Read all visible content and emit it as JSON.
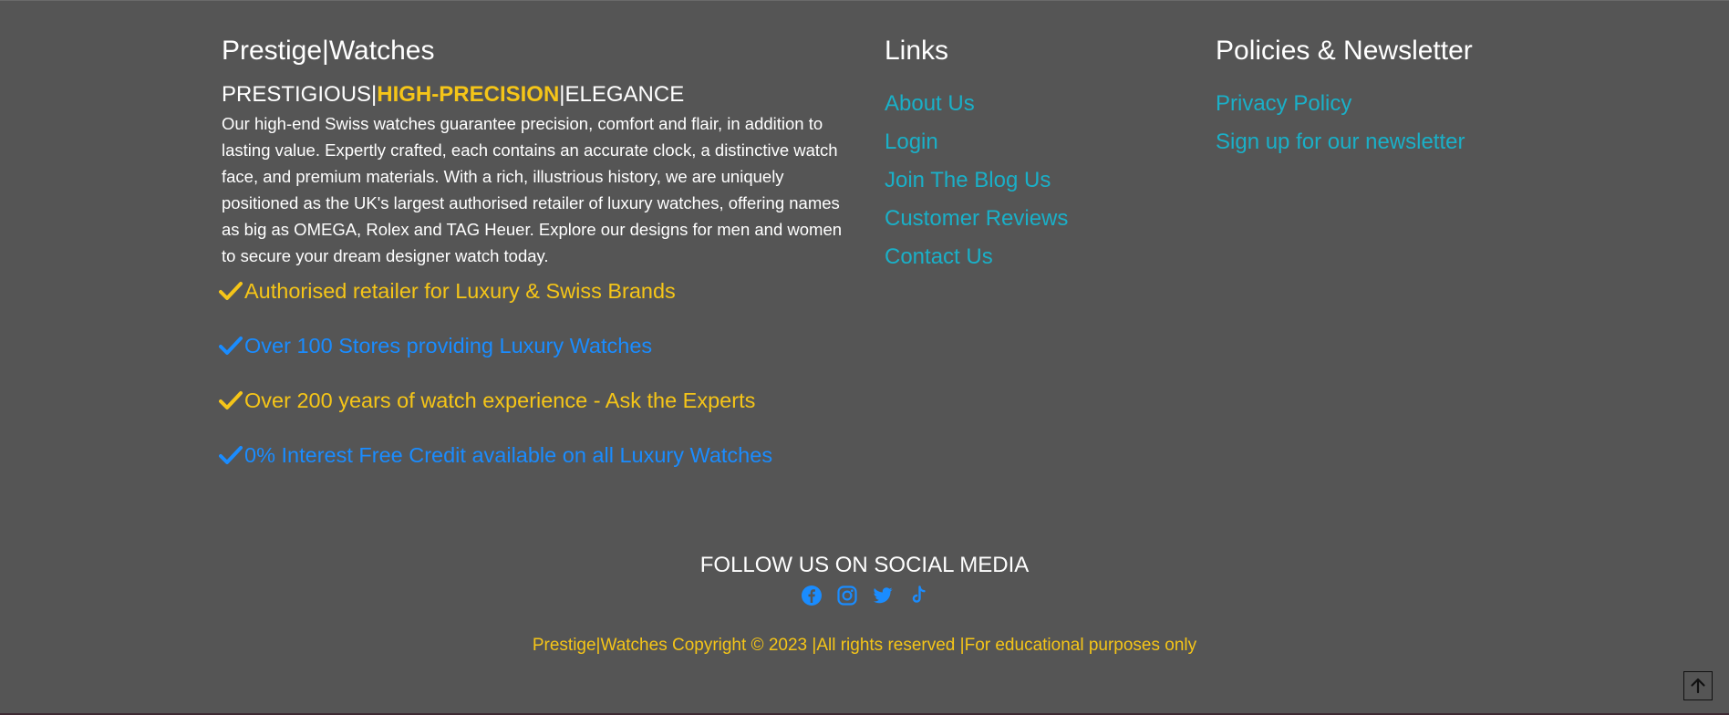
{
  "brand": {
    "title": "Prestige|Watches"
  },
  "tagline": {
    "part1": "PRESTIGIOUS|",
    "part2": "HIGH-PRECISION",
    "part3": "|ELEGANCE"
  },
  "about": {
    "text": "Our high-end Swiss watches guarantee precision, comfort and flair, in addition to lasting value. Expertly crafted, each contains an accurate clock, a distinctive watch face, and premium materials. With a rich, illustrious history, we are uniquely positioned as the UK's largest authorised retailer of luxury watches, offering names as big as OMEGA, Rolex and TAG Heuer. Explore our designs for men and women to secure your dream designer watch today."
  },
  "features": [
    {
      "label": "Authorised retailer for Luxury & Swiss Brands",
      "color": "#f5c518"
    },
    {
      "label": "Over 100 Stores providing Luxury Watches",
      "color": "#1a8cff"
    },
    {
      "label": "Over 200 years of watch experience - Ask the Experts",
      "color": "#f5c518"
    },
    {
      "label": "0% Interest Free Credit available on all Luxury Watches",
      "color": "#1a8cff"
    }
  ],
  "links": {
    "heading": "Links",
    "items": [
      "About Us",
      "Login",
      "Join The Blog Us",
      "Customer Reviews",
      "Contact Us"
    ]
  },
  "policies": {
    "heading": "Policies & Newsletter",
    "items": [
      "Privacy Policy",
      "Sign up for our newsletter"
    ]
  },
  "social": {
    "heading": "FOLLOW US ON SOCIAL MEDIA",
    "icons": [
      "facebook-icon",
      "instagram-icon",
      "twitter-icon",
      "tiktok-icon"
    ]
  },
  "copyright": "Prestige|Watches Copyright © 2023 |All rights reserved |For educational purposes only",
  "colors": {
    "background": "#555555",
    "accent_yellow": "#f5c518",
    "accent_blue": "#1a8cff",
    "link_teal": "#1ab0c8"
  },
  "back_to_top": {
    "icon": "arrow-up-icon"
  }
}
